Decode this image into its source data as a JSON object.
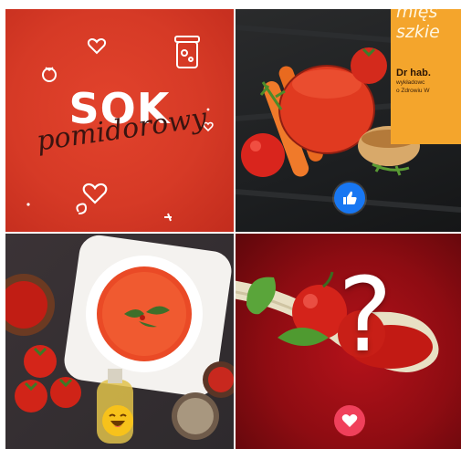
{
  "tiles": {
    "sok": {
      "title": "SOK",
      "subtitle": "pomidorowy"
    },
    "juice": {
      "ad": {
        "line1": "mięs",
        "line2": "szkie",
        "author": "Dr hab.",
        "desc1": "wykładowc",
        "desc2": "o Zdrowiu W"
      },
      "reaction": "like-icon"
    },
    "soup": {
      "reaction": "haha-icon"
    },
    "question": {
      "symbol": "?",
      "reaction": "love-icon"
    }
  },
  "colors": {
    "sok_bg": "#d63a26",
    "ad_orange": "#f4a52c",
    "like_blue": "#1877f2",
    "love_red": "#f0405b",
    "haha_yellow": "#f7c21b"
  }
}
